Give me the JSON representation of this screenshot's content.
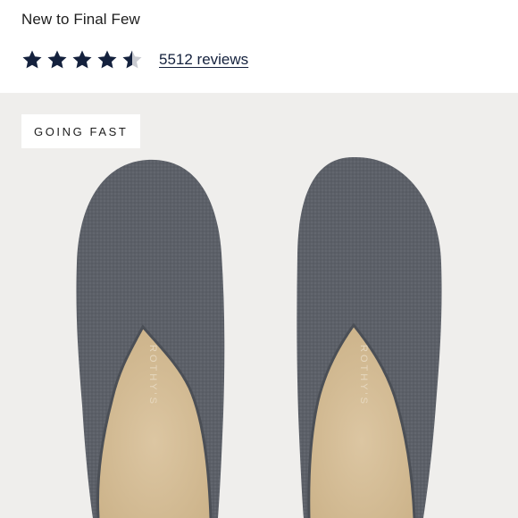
{
  "header": {
    "collection_label": "New to Final Few",
    "rating": {
      "value": 4.5,
      "max": 5,
      "color": "#14213d",
      "empty_color": "#c9cbd1"
    },
    "reviews_link": "5512 reviews"
  },
  "product": {
    "badge": "GOING FAST",
    "image_alt": "Grey knit slipper mules, top view",
    "brand_mark": "ROTHY'S",
    "colors": {
      "knit": "#5c6068",
      "footbed": "#d7c09a",
      "background": "#efeeec"
    }
  }
}
